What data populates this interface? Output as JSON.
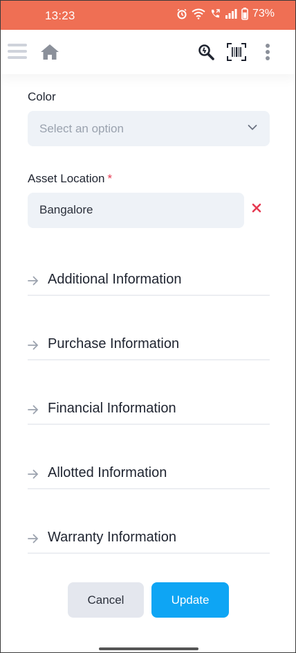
{
  "status_bar": {
    "time": "13:23",
    "battery": "73%",
    "icons": [
      "alarm-icon",
      "wifi-icon",
      "call-icon",
      "signal-icon",
      "battery-icon"
    ]
  },
  "header": {
    "icons": [
      "menu-icon",
      "home-icon",
      "search-icon",
      "barcode-scan-icon",
      "more-vertical-icon"
    ]
  },
  "form": {
    "color": {
      "label": "Color",
      "placeholder": "Select an option"
    },
    "asset_location": {
      "label": "Asset Location",
      "required_mark": "*",
      "value": "Bangalore"
    }
  },
  "sections": [
    {
      "title": "Additional Information"
    },
    {
      "title": "Purchase Information"
    },
    {
      "title": "Financial Information"
    },
    {
      "title": "Allotted Information"
    },
    {
      "title": "Warranty Information"
    }
  ],
  "actions": {
    "cancel_label": "Cancel",
    "update_label": "Update"
  },
  "colors": {
    "status_bar": "#ef6f54",
    "primary": "#0ea5f4",
    "required": "#e63950",
    "field_bg": "#eef2f7"
  }
}
